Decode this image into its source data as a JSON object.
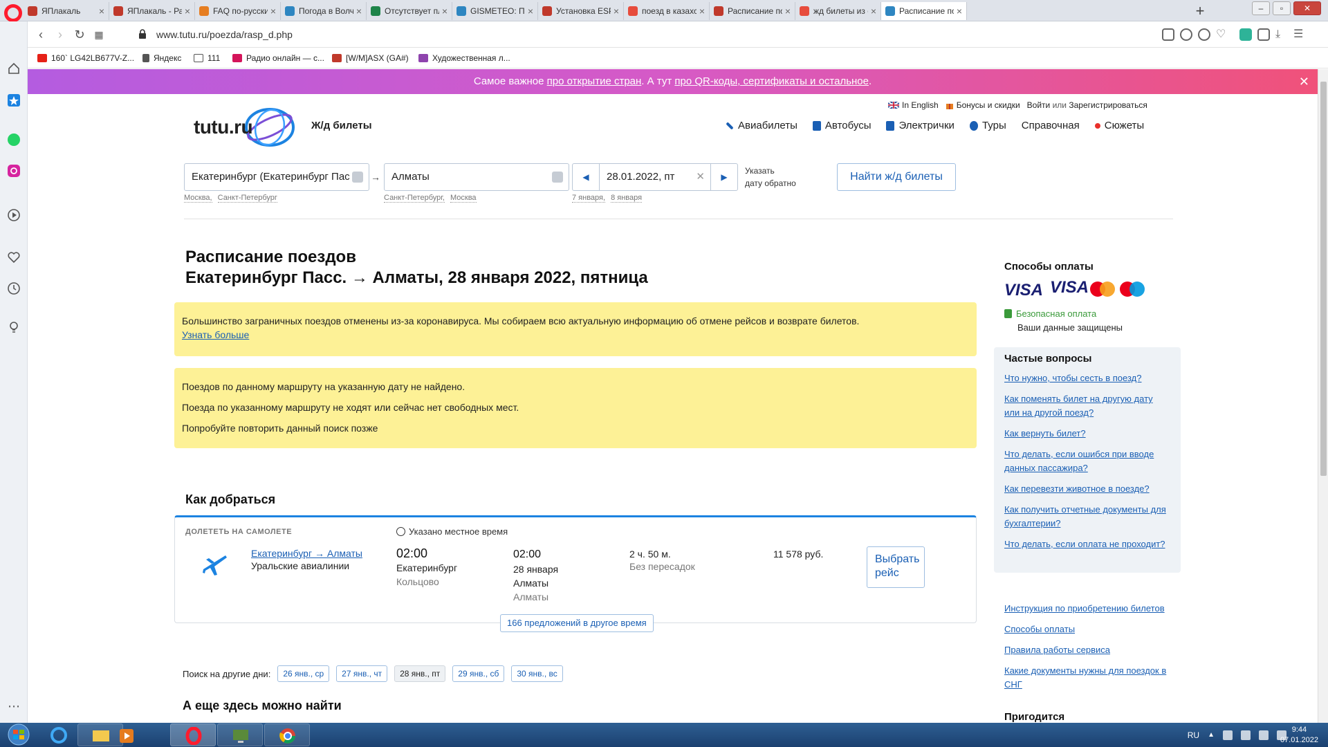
{
  "browser": {
    "tabs": [
      {
        "title": "ЯПлакаль",
        "color": "#c0392b"
      },
      {
        "title": "ЯПлакаль - Разде",
        "color": "#c0392b"
      },
      {
        "title": "FAQ по-русски - I",
        "color": "#e67e22"
      },
      {
        "title": "Погода в Волчан",
        "color": "#2e86c1"
      },
      {
        "title": "Отсутствует плом",
        "color": "#1e8449"
      },
      {
        "title": "GISMETEO: Погод",
        "color": "#2e86c1"
      },
      {
        "title": "Установка ESP —",
        "color": "#c0392b"
      },
      {
        "title": "поезд в казахстан",
        "color": "#e74c3c"
      },
      {
        "title": "Расписание поезд",
        "color": "#c0392b"
      },
      {
        "title": "жд билеты из ека",
        "color": "#e74c3c"
      },
      {
        "title": "Расписание поезд",
        "color": "#2e86c1",
        "active": true
      }
    ],
    "url": "www.tutu.ru/poezda/rasp_d.php",
    "bookmarks": [
      {
        "label": "160` LG42LB677V-Z...",
        "color": "#e62117"
      },
      {
        "label": "Яндекс",
        "color": "#555"
      },
      {
        "label": "111",
        "color": "#555"
      },
      {
        "label": "Радио онлайн — с...",
        "color": "#d4145a"
      },
      {
        "label": "[W/M]ASX (GA#)",
        "color": "#c0392b"
      },
      {
        "label": "Художественная л...",
        "color": "#8e44ad"
      }
    ]
  },
  "promo": {
    "text1": "Самое важное ",
    "link1": "про открытие стран",
    "text2": ". А тут ",
    "link2": "про QR-коды, сертификаты и остальное",
    "text3": "."
  },
  "header": {
    "logo": "tutu.ru",
    "section": "Ж/д билеты",
    "top_links": {
      "english": "In English",
      "bonus": "Бонусы и скидки",
      "login": "Войти",
      "or": "или",
      "register": "Зарегистрироваться"
    },
    "nav": [
      "Авиабилеты",
      "Автобусы",
      "Электрички",
      "Туры",
      "Справочная",
      "Сюжеты"
    ]
  },
  "search": {
    "from": "Екатеринбург (Екатеринбург Пас",
    "to": "Алматы",
    "date": "28.01.2022, пт",
    "from_hints": [
      "Москва,",
      "Санкт-Петербург"
    ],
    "to_hints": [
      "Санкт-Петербург,",
      "Москва"
    ],
    "date_hints": [
      "7 января,",
      "8 января"
    ],
    "return_label_1": "Указать",
    "return_label_2": "дату обратно",
    "find_button": "Найти ж/д билеты"
  },
  "main": {
    "title_line1": "Расписание поездов",
    "title_line2": "Екатеринбург Пасс. → Алматы, 28 января 2022, пятница",
    "notice1_text": "Большинство заграничных поездов отменены из-за коронавируса. Мы собираем всю актуальную информацию об отмене рейсов и возврате билетов.",
    "notice1_link": "Узнать больше",
    "notice2_lines": [
      "Поездов по данному маршруту на указанную дату не найдено.",
      "Поезда по указанному маршруту не ходят или сейчас нет свободных мест.",
      "Попробуйте повторить данный поиск позже"
    ],
    "how_title": "Как добраться",
    "flight": {
      "header": "ДОЛЕТЕТЬ НА САМОЛЕТЕ",
      "tz_note": "Указано местное время",
      "route": "Екатеринбург → Алматы",
      "airline": "Уральские авиалинии",
      "dep_time": "02:00",
      "dep_city": "Екатеринбург",
      "dep_airport": "Кольцово",
      "arr_time": "02:00",
      "arr_date": "28 января",
      "arr_city": "Алматы",
      "arr_airport": "Алматы",
      "duration": "2 ч. 50 м.",
      "stops": "Без пересадок",
      "price": "11 578 руб.",
      "choose_1": "Выбрать",
      "choose_2": "рейс",
      "more_offers": "166 предложений в другое время"
    },
    "other_days_label": "Поиск на другие дни:",
    "other_days": [
      "26 янв., ср",
      "27 янв., чт",
      "28 янв., пт",
      "29 янв., сб",
      "30 янв., вс"
    ],
    "current_day_index": 2,
    "also_title": "А еще здесь можно найти"
  },
  "aside": {
    "pay_title": "Способы оплаты",
    "secure": "Безопасная оплата",
    "secure_sub": "Ваши данные защищены",
    "faq_title": "Частые вопросы",
    "faq": [
      "Что нужно, чтобы сесть в поезд?",
      "Как поменять билет на другую дату или на другой поезд?",
      "Как вернуть билет?",
      "Что делать, если ошибся при вводе данных пассажира?",
      "Как перевезти животное в поезде?",
      "Как получить отчетные документы для бухгалтерии?",
      "Что делать, если оплата не проходит?"
    ],
    "links": [
      "Инструкция по приобретению билетов",
      "Способы оплаты",
      "Правила работы сервиса",
      "Какие документы нужны для поездок в СНГ"
    ],
    "useful": "Пригодится"
  },
  "taskbar": {
    "lang": "RU",
    "time": "9:44",
    "date": "07.01.2022"
  },
  "colors": {
    "accent": "#1a5fb4",
    "notice": "#fdf196",
    "card_top": "#1c83e1",
    "promo_from": "#b45ce0",
    "promo_to": "#f0527a"
  }
}
